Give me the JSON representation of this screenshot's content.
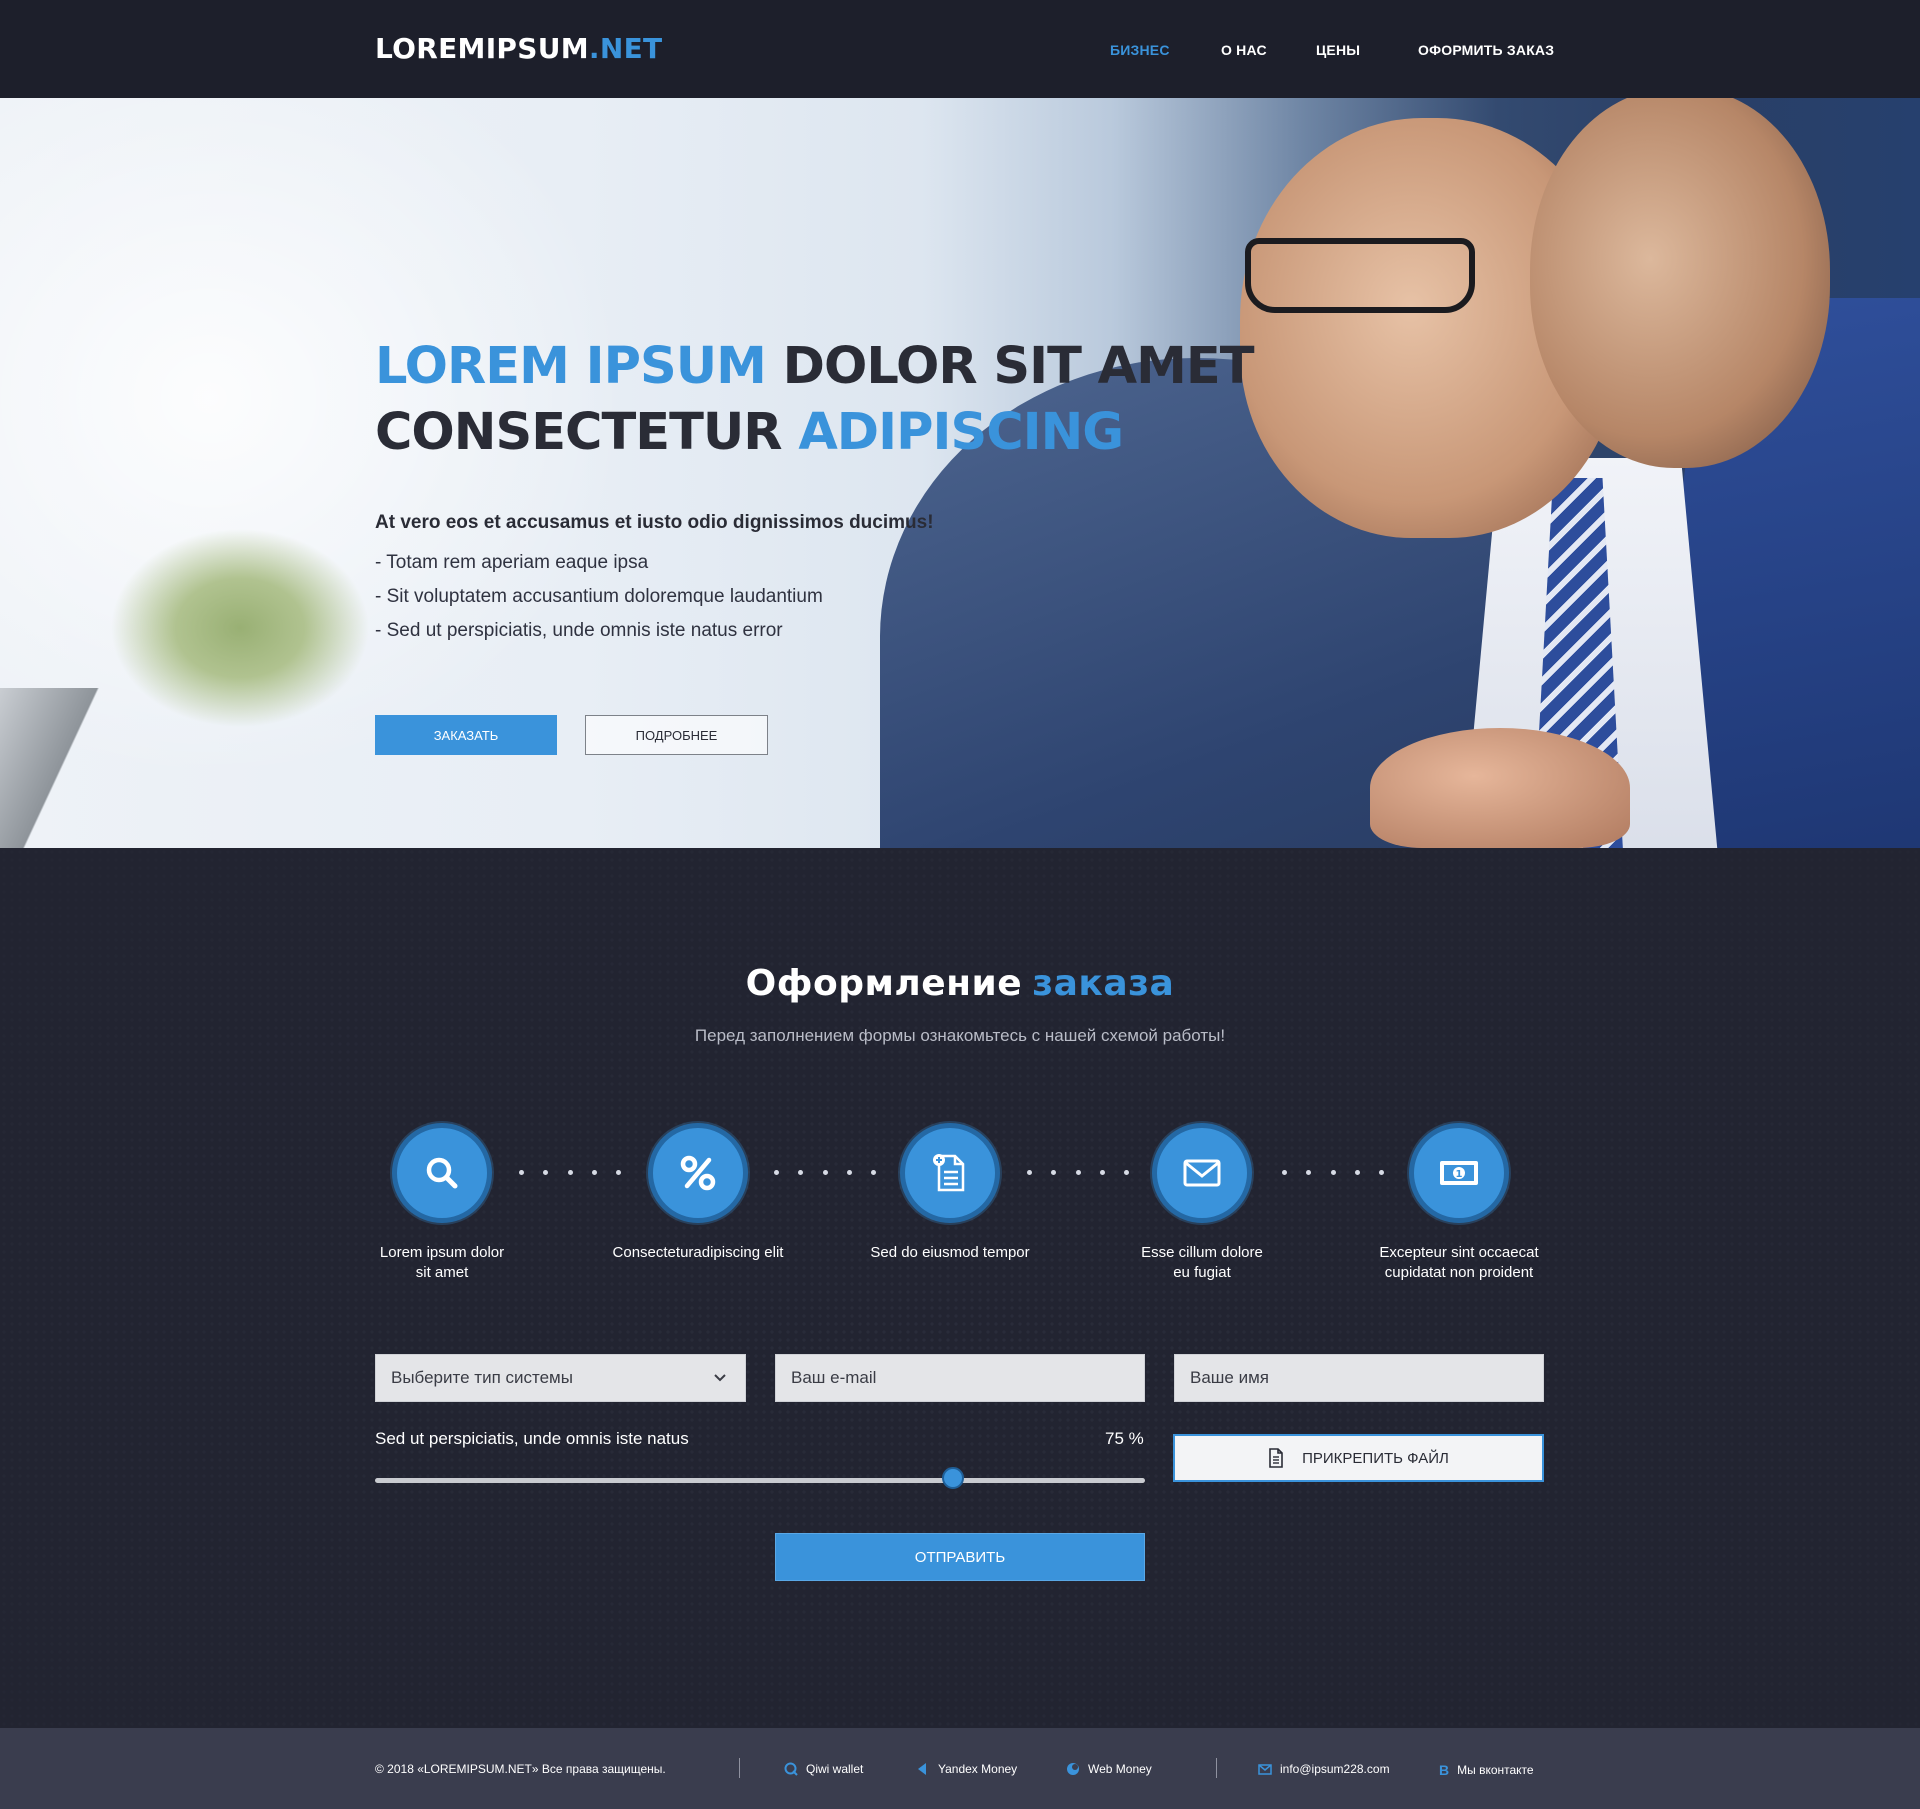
{
  "header": {
    "logo_main": "LOREMIPSUM",
    "logo_accent": ".NET",
    "nav": [
      {
        "label": "Бизнес",
        "active": true
      },
      {
        "label": "О нас",
        "active": false
      },
      {
        "label": "Цены",
        "active": false
      },
      {
        "label": "Оформить заказ",
        "active": false
      }
    ]
  },
  "hero": {
    "title_part1_blue": "LOREM IPSUM",
    "title_part2": "DOLOR SIT AMET",
    "title_part3": "CONSECTETUR",
    "title_part4_blue": "ADIPISCING",
    "lead": "At vero eos et accusamus et iusto odio dignissimos ducimus!",
    "list": [
      "- Totam rem aperiam eaque ipsa",
      "- Sit voluptatem accusantium doloremque laudantium",
      "- Sed ut perspiciatis, unde omnis iste natus error"
    ],
    "btn_order": "Заказать",
    "btn_more": "Подробнее"
  },
  "order": {
    "title": "Оформление",
    "title_blue": "заказа",
    "subtitle": "Перед заполнением формы ознакомьтесь с нашей схемой работы!",
    "steps": [
      {
        "icon": "search-icon",
        "label_line1": "Lorem ipsum dolor",
        "label_line2": "sit amet"
      },
      {
        "icon": "percent-icon",
        "label_line1": "Consecteturadipiscing elit",
        "label_line2": ""
      },
      {
        "icon": "document-add-icon",
        "label_line1": "Sed do eiusmod tempor",
        "label_line2": ""
      },
      {
        "icon": "envelope-icon",
        "label_line1": "Esse cillum dolore",
        "label_line2": "eu fugiat"
      },
      {
        "icon": "banknote-icon",
        "label_line1": "Excepteur sint occaecat",
        "label_line2": "cupidatat non proident"
      }
    ],
    "select_system": "Выберите тип системы",
    "email_placeholder": "Ваш e-mail",
    "name_placeholder": "Ваше имя",
    "slider_label": "Sed ut perspiciatis, unde omnis iste natus",
    "slider_value_text": "75 %",
    "slider_value": 75,
    "attach_label": "Прикрепить файл",
    "submit_label": "Отправить"
  },
  "footer": {
    "copyright": "© 2018 «LOREMIPSUM.NET» Все права защищены.",
    "payments": [
      {
        "icon": "qiwi-icon",
        "label": "Qiwi wallet"
      },
      {
        "icon": "yandex-money-icon",
        "label": "Yandex Money"
      },
      {
        "icon": "webmoney-icon",
        "label": "Web Money"
      }
    ],
    "email": "info@ipsum228.com",
    "vk": "Мы вконтакте"
  },
  "colors": {
    "accent": "#3a93db",
    "dark_bg": "#222431",
    "header_bg": "#1d1f2b",
    "footer_bg": "#3a3d4e"
  }
}
